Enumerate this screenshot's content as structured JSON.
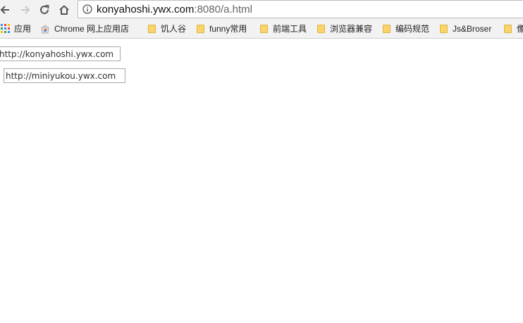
{
  "toolbar": {
    "back_icon": "back-arrow-icon",
    "forward_icon": "forward-arrow-icon",
    "reload_icon": "reload-icon",
    "home_icon": "home-icon",
    "address": {
      "info_icon": "info-icon",
      "host": "konyahoshi.ywx.com",
      "path": ":8080/a.html"
    }
  },
  "bookmarks": {
    "items": [
      {
        "label": "应用",
        "icon": "apps-grid-icon"
      },
      {
        "label": "Chrome 网上应用店",
        "icon": "chrome-webstore-icon"
      },
      {
        "label": "饥人谷",
        "icon": "folder-icon"
      },
      {
        "label": "funny常用",
        "icon": "folder-icon"
      },
      {
        "label": "前端工具",
        "icon": "folder-icon"
      },
      {
        "label": "浏览器兼容",
        "icon": "folder-icon"
      },
      {
        "label": "编码规范",
        "icon": "folder-icon"
      },
      {
        "label": "Js&Broser",
        "icon": "folder-icon"
      },
      {
        "label": "像",
        "icon": "folder-icon"
      }
    ]
  },
  "page": {
    "inputs": [
      {
        "value": "http://konyahoshi.ywx.com",
        "placeholder": ""
      },
      {
        "value": "http://miniyukou.ywx.com",
        "placeholder": ""
      }
    ]
  },
  "colors": {
    "toolbar_bg": "#f2f2f2",
    "folder": "#f9d46a",
    "apps_grid": [
      "#4285f4",
      "#ea4335",
      "#fbbc05",
      "#34a853"
    ]
  }
}
